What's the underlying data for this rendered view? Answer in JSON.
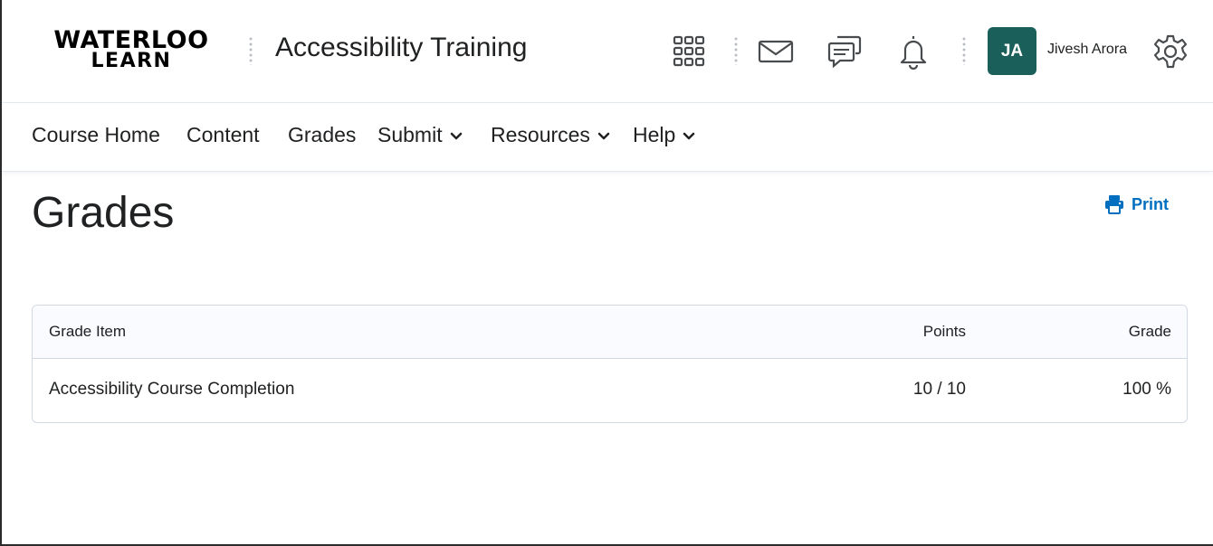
{
  "header": {
    "logo_line1": "WATERLOO",
    "logo_line2": "LEARN",
    "course_title": "Accessibility Training",
    "user_initials": "JA",
    "user_name": "Jivesh Arora",
    "avatar_color": "#1a5f5a",
    "icons": [
      "app-grid-icon",
      "mail-icon",
      "chat-icon",
      "bell-icon",
      "gear-icon"
    ]
  },
  "nav": {
    "items": [
      {
        "label": "Course Home",
        "dropdown": false
      },
      {
        "label": "Content",
        "dropdown": false
      },
      {
        "label": "Grades",
        "dropdown": false
      },
      {
        "label": "Submit",
        "dropdown": true
      },
      {
        "label": "Resources",
        "dropdown": true
      },
      {
        "label": "Help",
        "dropdown": true
      }
    ]
  },
  "main": {
    "page_title": "Grades",
    "print_label": "Print",
    "accent_color": "#006fbf",
    "table": {
      "columns": [
        "Grade Item",
        "Points",
        "Grade"
      ],
      "rows": [
        [
          "Accessibility Course Completion",
          "10 / 10",
          "100 %"
        ]
      ]
    }
  }
}
